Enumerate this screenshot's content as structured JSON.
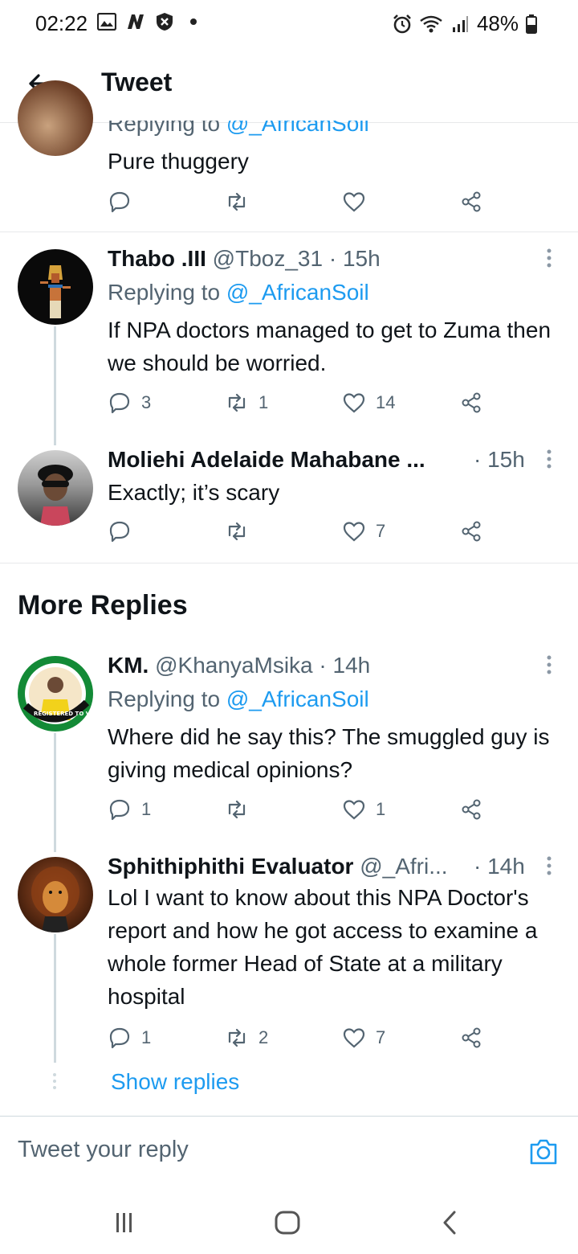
{
  "status": {
    "time": "02:22",
    "battery": "48%"
  },
  "header": {
    "title": "Tweet"
  },
  "top_partial": {
    "reply_to_prefix": "Replying to",
    "reply_to_handle": "@_AfricanSoil",
    "text": "Pure thuggery"
  },
  "tweets": [
    {
      "name": "Thabo .III",
      "handle": "@Tboz_31",
      "time": "· 15h",
      "reply_to_prefix": "Replying to",
      "reply_to_handle": "@_AfricanSoil",
      "text": "If NPA doctors managed to get to Zuma then we should be worried.",
      "replies": "3",
      "retweets": "1",
      "likes": "14"
    },
    {
      "name": "Moliehi Adelaide Mahabane ...",
      "handle": "",
      "time": "· 15h",
      "text": "Exactly; it’s scary",
      "replies": "",
      "retweets": "",
      "likes": "7"
    }
  ],
  "more_replies": {
    "title": "More Replies",
    "tweets": [
      {
        "name": "KM.",
        "handle": "@KhanyaMsika",
        "time": "· 14h",
        "reply_to_prefix": "Replying to",
        "reply_to_handle": "@_AfricanSoil",
        "text": "Where did he say this? The smuggled guy is giving medical opinions?",
        "replies": "1",
        "retweets": "",
        "likes": "1",
        "avatar_badge": "REGISTERED TO VOTE ANC"
      },
      {
        "name": "Sphithiphithi Evaluator",
        "handle": "@_Afri...",
        "time": "· 14h",
        "text": "Lol I want to know about this NPA Doctor's report and how he got access to examine a whole former Head of State at a military hospital",
        "replies": "1",
        "retweets": "2",
        "likes": "7"
      }
    ],
    "show_replies": "Show replies"
  },
  "reply_box": {
    "placeholder": "Tweet your reply"
  },
  "colors": {
    "accent": "#1d9bf0",
    "muted": "#536471",
    "text": "#0f1419",
    "divider": "#e7e9ea"
  },
  "icons": {
    "back": "arrow-left-icon",
    "reply": "comment-icon",
    "retweet": "retweet-icon",
    "like": "heart-icon",
    "share": "share-icon",
    "more": "more-vertical-icon",
    "camera": "camera-icon"
  }
}
